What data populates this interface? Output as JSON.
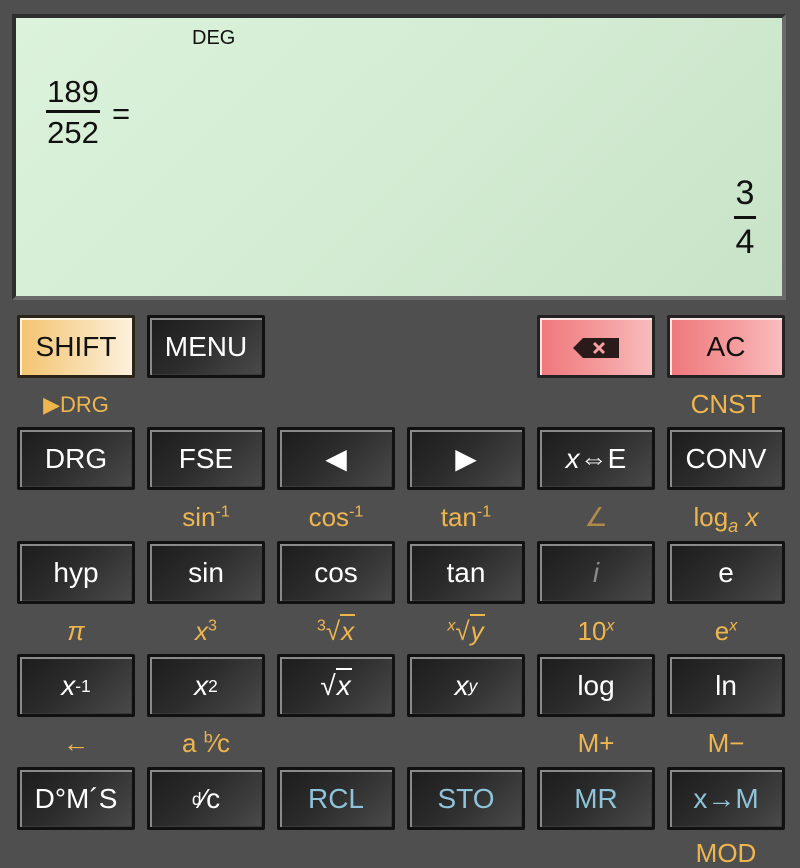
{
  "display": {
    "angle_mode": "DEG",
    "expression": {
      "numerator": "189",
      "denominator": "252",
      "equals": "="
    },
    "result": {
      "numerator": "3",
      "denominator": "4"
    }
  },
  "colors": {
    "background": "#4f4f4f",
    "display_bg": "#d3ecd3",
    "shift_label": "#f0b64e",
    "memory_key_text": "#8fc3d9",
    "shift_key": "#f4c470",
    "clear_keys": "#ef777b"
  },
  "keys": {
    "row1": {
      "shift": "SHIFT",
      "menu": "MENU",
      "backspace_icon": "backspace-icon",
      "ac": "AC"
    },
    "row1_shift_labels": {
      "drg_arrow": "▶DRG",
      "cnst": "CNST"
    },
    "row2": {
      "drg": "DRG",
      "fse": "FSE",
      "left": "◀",
      "right": "▶",
      "x_exp": {
        "x": "x",
        "rest": "⇔E"
      },
      "conv": "CONV"
    },
    "row2_shift_labels": {
      "asin": {
        "base": "sin",
        "sup": "-1"
      },
      "acos": {
        "base": "cos",
        "sup": "-1"
      },
      "atan": {
        "base": "tan",
        "sup": "-1"
      },
      "angle": "∠",
      "loga": {
        "base": "log",
        "sub": "a",
        "x": " x"
      }
    },
    "row3": {
      "hyp": "hyp",
      "sin": "sin",
      "cos": "cos",
      "tan": "tan",
      "i": "i",
      "e": "e"
    },
    "row3_shift_labels": {
      "pi": "π",
      "cube": {
        "base": "x",
        "sup": "3"
      },
      "cbrt": {
        "index": "3",
        "radicand": "x"
      },
      "xroot": {
        "index": "x",
        "radicand": "y"
      },
      "pow10": {
        "base": "10",
        "sup": "x"
      },
      "exp": {
        "base": "e",
        "sup": "x"
      }
    },
    "row4": {
      "inverse": {
        "base": "x",
        "sup": "-1"
      },
      "square": {
        "base": "x",
        "sup": "2"
      },
      "sqrt": {
        "radicand": "x"
      },
      "power": {
        "base": "x",
        "sup": "y"
      },
      "log": "log",
      "ln": "ln"
    },
    "row4_shift_labels": {
      "back_arrow": "←",
      "mixed_frac": {
        "a": "a ",
        "b": "b",
        "slash": "⁄",
        "c": "c"
      },
      "m_plus": "M+",
      "m_minus": "M−"
    },
    "row5": {
      "dms": "D°M´S",
      "d_c": {
        "d": "d",
        "slash": "⁄",
        "c": "c"
      },
      "rcl": "RCL",
      "sto": "STO",
      "mr": "MR",
      "x_to_m": "x→M"
    },
    "row5_shift_labels": {
      "mod": "MOD"
    }
  }
}
